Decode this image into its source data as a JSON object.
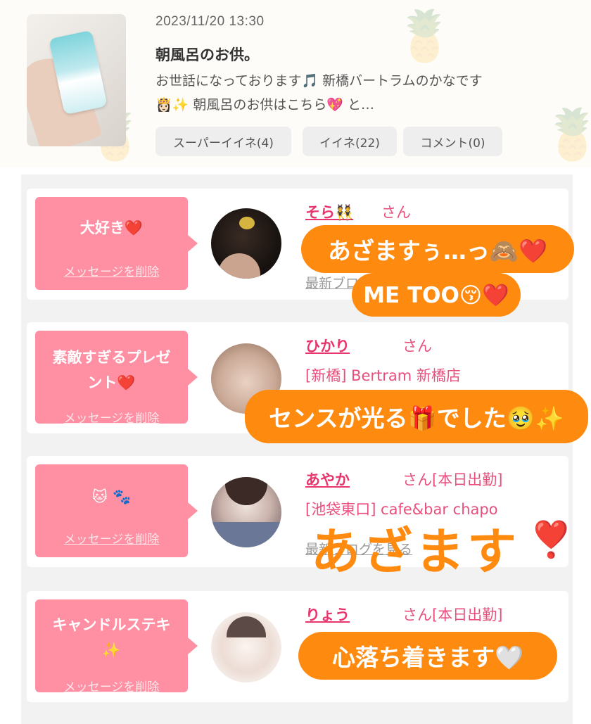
{
  "post": {
    "date": "2023/11/20 13:30",
    "title": "朝風呂のお供。",
    "excerpt_line1": "お世話になっております🎵 新橋バートラムのかなです",
    "excerpt_line2": "👸🏻✨ 朝風呂のお供はこちら💖 と…",
    "buttons": {
      "super_like": "スーパーイイネ(4)",
      "like": "イイネ(22)",
      "comment": "コメント(0)"
    }
  },
  "cards": [
    {
      "message": "大好き❤️",
      "message_line2": "",
      "delete_label": "メッセージを削除",
      "name": "そら👯",
      "suffix": "さん",
      "shop": "",
      "link": "最新ブログを見る"
    },
    {
      "message": "素敵すぎるプレゼ",
      "message_line2": "ント❤️",
      "delete_label": "メッセージを削除",
      "name": "ひかり",
      "suffix": "さん",
      "shop": "[新橋] Bertram 新橋店",
      "link": ""
    },
    {
      "message": "🐱 🐾",
      "message_line2": "",
      "delete_label": "メッセージを削除",
      "name": "あやか",
      "suffix": "さん[本日出勤]",
      "shop": "[池袋東口] cafe&bar chapo",
      "link": "最新ブログを見る"
    },
    {
      "message": "キャンドルステキ",
      "message_line2": "✨",
      "delete_label": "メッセージを削除",
      "name": "りょう",
      "suffix": "さん[本日出勤]",
      "shop": "",
      "link": ""
    }
  ],
  "stickers": {
    "s1": "あざますぅ…っ🙈❤️",
    "s2": "ME TOO😚❤️",
    "s3": "センスが光る🎁でした🥹✨",
    "s4": "あざます",
    "s4_mark": "❣️",
    "s5": "心落ち着きます🤍"
  },
  "colors": {
    "accent_pink": "#ff8fa3",
    "name_pink": "#e8356b",
    "sticker_orange": "#ff8a10"
  }
}
